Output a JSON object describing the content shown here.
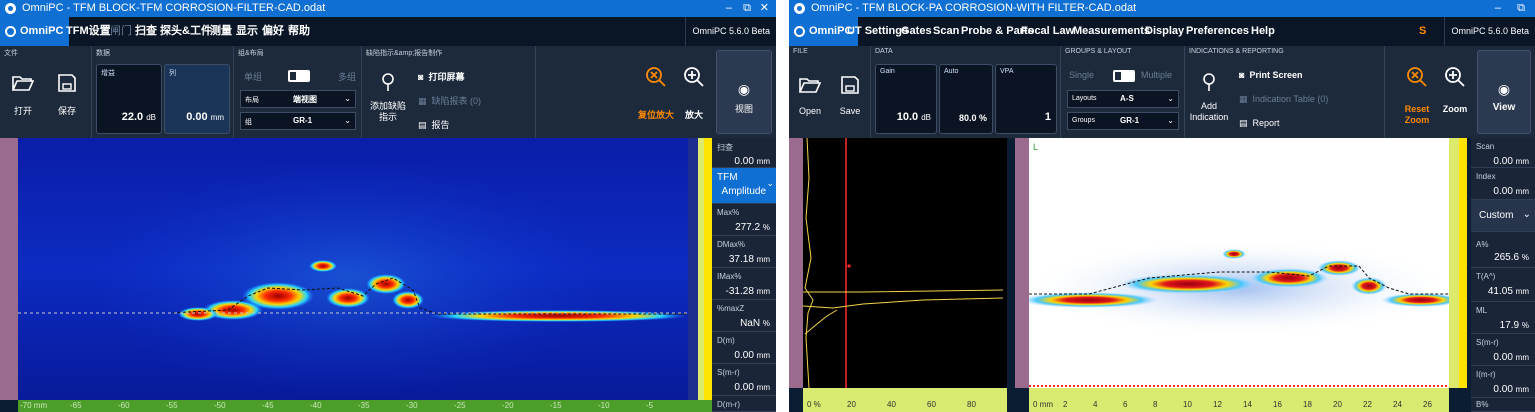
{
  "left": {
    "title": "OmniPC - TFM BLOCK-TFM CORROSION-FILTER-CAD.odat",
    "menu": [
      "OmniPC",
      "TFM设置",
      "闸门",
      "扫查",
      "探头&工件",
      "测量",
      "显示",
      "偏好",
      "帮助"
    ],
    "version": "OmniPC 5.6.0 Beta",
    "ribbon": {
      "file_title": "文件",
      "open": "打开",
      "save": "保存",
      "data_title": "数据",
      "gain_label": "增益",
      "gain_value": "22.0",
      "gain_unit": "dB",
      "col_label": "列",
      "col_value": "0.00",
      "col_unit": "mm",
      "groups_title": "组&布局",
      "single": "单组",
      "multiple": "多组",
      "layout_key": "布局",
      "layout_value": "端视图",
      "group_key": "组",
      "group_value": "GR-1",
      "indications_title": "缺陷指示&amp;报告制作",
      "add_indication": "添加缺陷指示",
      "print_screen": "打印屏幕",
      "indication_table": "缺陷报表 (0)",
      "report": "报告",
      "reset_zoom": "复位放大",
      "zoom": "放大",
      "view": "视图"
    },
    "readouts": [
      {
        "label": "扫查",
        "value": "0.00",
        "unit": "mm"
      },
      {
        "label": "TFM",
        "value": "Amplitude",
        "unit": ""
      },
      {
        "label": "Max%",
        "value": "277.2",
        "unit": "%"
      },
      {
        "label": "DMax%",
        "value": "37.18",
        "unit": "mm"
      },
      {
        "label": "IMax%",
        "value": "-31.28",
        "unit": "mm"
      },
      {
        "label": "%maxZ",
        "value": "NaN",
        "unit": "%"
      },
      {
        "label": "D(m)",
        "value": "0.00",
        "unit": "mm"
      },
      {
        "label": "S(m-r)",
        "value": "0.00",
        "unit": "mm"
      },
      {
        "label": "D(m-r)",
        "value": "",
        "unit": ""
      }
    ],
    "bottom_ruler": [
      "-70 mm",
      "-65",
      "-60",
      "-55",
      "-50",
      "-45",
      "-40",
      "-35",
      "-30",
      "-25",
      "-20",
      "-15",
      "-10",
      "-5"
    ]
  },
  "right": {
    "title": "OmniPC - TFM BLOCK-PA CORROSION-WITH FILTER-CAD.odat",
    "menu": [
      "OmniPC",
      "UT Settings",
      "Gates",
      "Scan",
      "Probe & Parts",
      "Focal Law",
      "Measurements",
      "Display",
      "Preferences",
      "Help"
    ],
    "version": "OmniPC 5.6.0 Beta",
    "s_badge": "S",
    "ribbon": {
      "file_title": "FILE",
      "open": "Open",
      "save": "Save",
      "data_title": "DATA",
      "gain_label": "Gain",
      "gain_value": "10.0",
      "gain_unit": "dB",
      "auto_label": "Auto",
      "auto_value": "80.0 %",
      "vpa_label": "VPA",
      "vpa_value": "1",
      "groups_title": "GROUPS & LAYOUT",
      "single": "Single",
      "multiple": "Multiple",
      "layout_key": "Layouts",
      "layout_value": "A-S",
      "group_key": "Groups",
      "group_value": "GR-1",
      "indications_title": "INDICATIONS & REPORTING",
      "add_indication": "Add Indication",
      "print_screen": "Print Screen",
      "indication_table": "Indication Table (0)",
      "report": "Report",
      "reset_zoom": "Reset Zoom",
      "zoom": "Zoom",
      "view": "View"
    },
    "readouts": [
      {
        "label": "Scan",
        "value": "0.00",
        "unit": "mm"
      },
      {
        "label": "Index",
        "value": "0.00",
        "unit": "mm"
      },
      {
        "label": "Custom",
        "value": "",
        "unit": ""
      },
      {
        "label": "A%",
        "value": "265.6",
        "unit": "%"
      },
      {
        "label": "T(A^)",
        "value": "41.05",
        "unit": "mm"
      },
      {
        "label": "ML",
        "value": "17.9",
        "unit": "%"
      },
      {
        "label": "S(m-r)",
        "value": "0.00",
        "unit": "mm"
      },
      {
        "label": "I(m-r)",
        "value": "0.00",
        "unit": "mm"
      },
      {
        "label": "B%",
        "value": "",
        "unit": ""
      }
    ],
    "ascan_ruler": [
      "0 %",
      "20",
      "40",
      "60",
      "80"
    ],
    "sscan_ruler": [
      "0 mm",
      "2",
      "4",
      "6",
      "8",
      "10",
      "12",
      "14",
      "16",
      "18",
      "20",
      "22",
      "24",
      "26"
    ],
    "sscan_label": "L"
  }
}
